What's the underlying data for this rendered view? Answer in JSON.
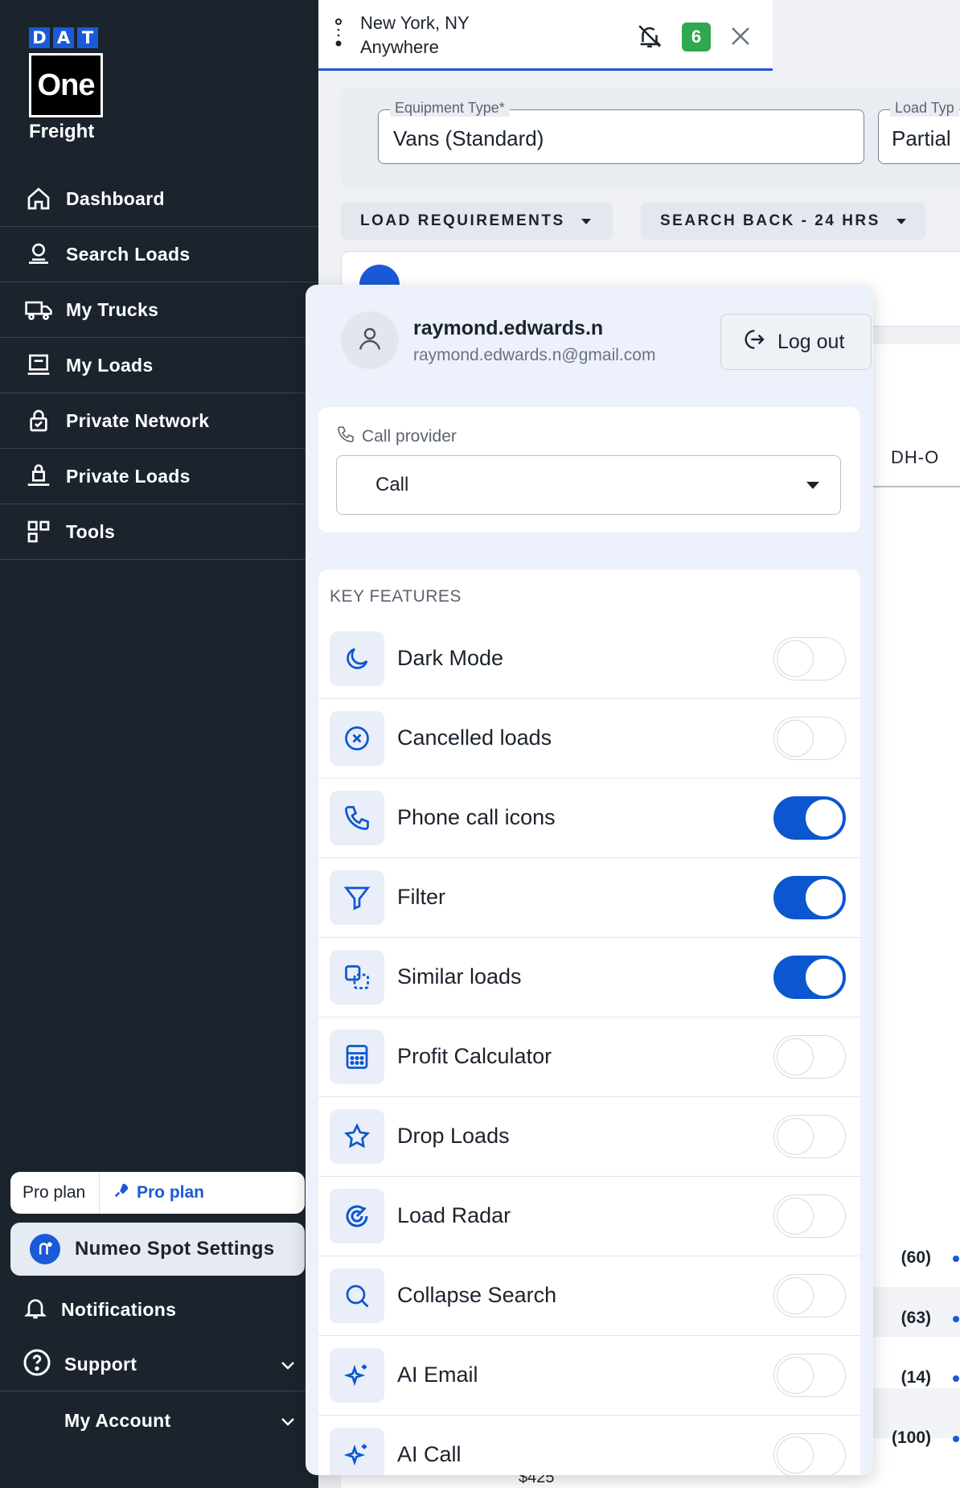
{
  "logo": {
    "letters": [
      "D",
      "A",
      "T"
    ],
    "one": "One",
    "freight": "Freight"
  },
  "sidebar": {
    "items": [
      {
        "label": "Dashboard",
        "icon": "home-icon"
      },
      {
        "label": "Search Loads",
        "icon": "search-loads-icon"
      },
      {
        "label": "My Trucks",
        "icon": "truck-icon"
      },
      {
        "label": "My Loads",
        "icon": "loads-icon"
      },
      {
        "label": "Private Network",
        "icon": "lock-icon"
      },
      {
        "label": "Private Loads",
        "icon": "private-loads-icon"
      },
      {
        "label": "Tools",
        "icon": "tools-icon"
      }
    ],
    "plan_left": "Pro plan",
    "plan_right": "Pro plan",
    "numeo": "Numeo Spot Settings",
    "notifications": "Notifications",
    "support": "Support",
    "account": "My Account"
  },
  "tab": {
    "origin": "New York, NY",
    "destination": "Anywhere",
    "badge": "6"
  },
  "search": {
    "equipment_label": "Equipment Type*",
    "equipment_value": "Vans (Standard)",
    "load_type_label": "Load Typ",
    "load_type_value": "Partial",
    "requirements": "LOAD REQUIREMENTS",
    "search_back": "SEARCH BACK - 24 HRS"
  },
  "results": {
    "column": "DH-O",
    "counts": [
      "(60)",
      "(63)",
      "(14)",
      "(100)"
    ],
    "price": "$425"
  },
  "panel": {
    "username": "raymond.edwards.n",
    "email": "raymond.edwards.n@gmail.com",
    "logout": "Log out",
    "call_label": "Call provider",
    "call_value": "Call",
    "features_title": "KEY FEATURES",
    "features": [
      {
        "label": "Dark Mode",
        "icon": "moon-icon",
        "enabled": false
      },
      {
        "label": "Cancelled loads",
        "icon": "cancel-circle-icon",
        "enabled": false
      },
      {
        "label": "Phone call icons",
        "icon": "phone-icon",
        "enabled": true
      },
      {
        "label": "Filter",
        "icon": "filter-icon",
        "enabled": true
      },
      {
        "label": "Similar loads",
        "icon": "similar-icon",
        "enabled": true
      },
      {
        "label": "Profit Calculator",
        "icon": "calculator-icon",
        "enabled": false
      },
      {
        "label": "Drop Loads",
        "icon": "star-icon",
        "enabled": false
      },
      {
        "label": "Load Radar",
        "icon": "radar-icon",
        "enabled": false
      },
      {
        "label": "Collapse Search",
        "icon": "magnifier-icon",
        "enabled": false
      },
      {
        "label": "AI Email",
        "icon": "sparkle-icon",
        "enabled": false
      },
      {
        "label": "AI Call",
        "icon": "sparkle-icon",
        "enabled": false
      }
    ]
  },
  "colors": {
    "accent": "#0b57d0",
    "sidebar": "#1b232d",
    "badge": "#2fa84f"
  }
}
